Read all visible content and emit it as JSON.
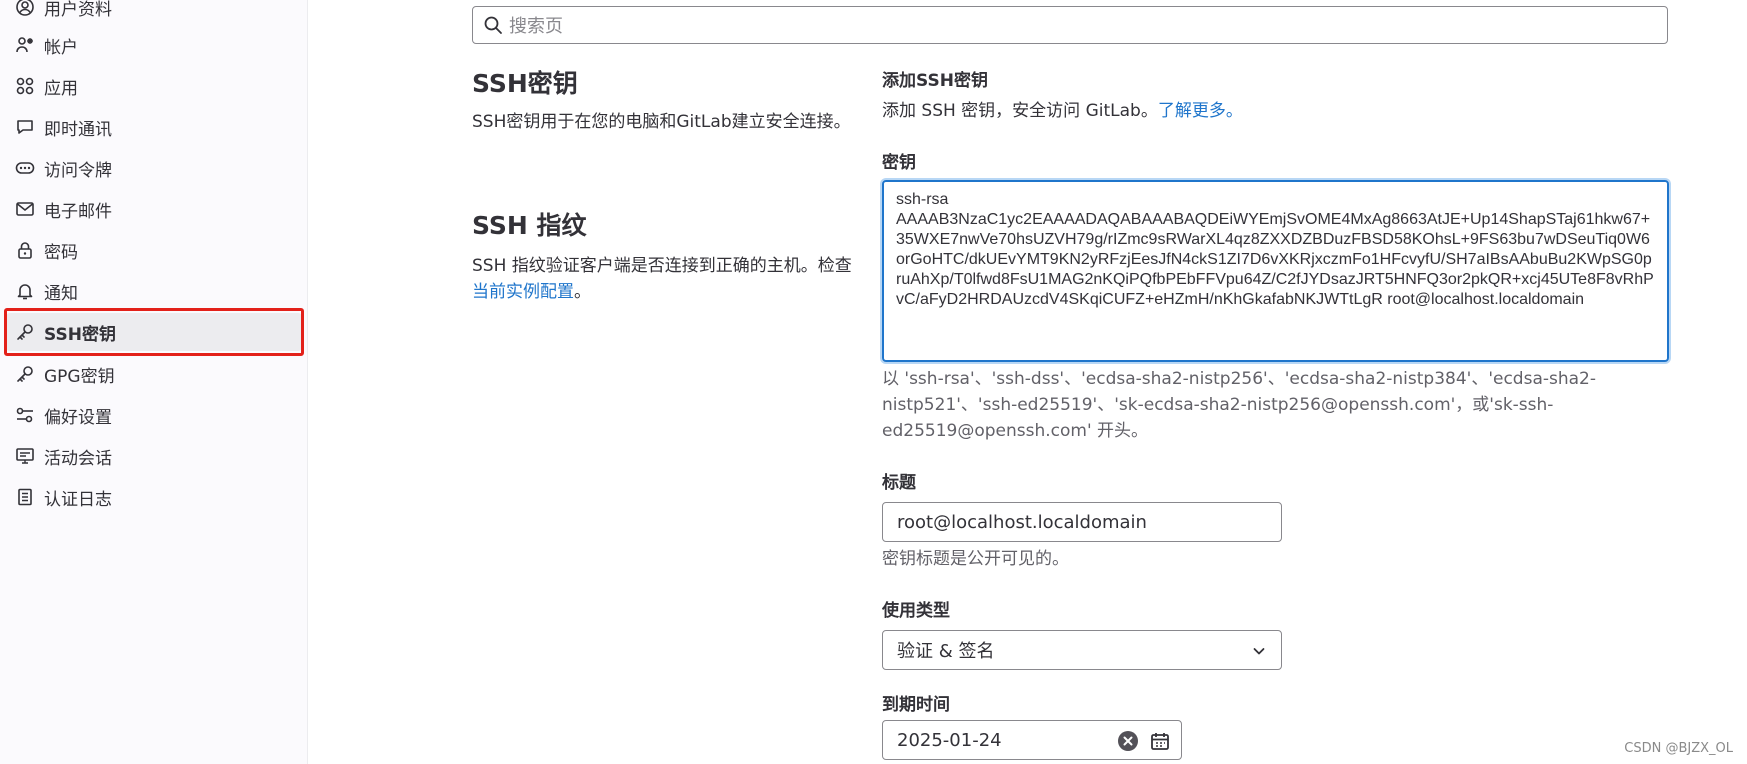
{
  "sidebar": {
    "items": [
      {
        "label": "用户资料",
        "icon": "user-circle-icon"
      },
      {
        "label": "帐户",
        "icon": "account-icon"
      },
      {
        "label": "应用",
        "icon": "applications-icon"
      },
      {
        "label": "即时通讯",
        "icon": "chat-icon"
      },
      {
        "label": "访问令牌",
        "icon": "token-icon"
      },
      {
        "label": "电子邮件",
        "icon": "mail-icon"
      },
      {
        "label": "密码",
        "icon": "lock-icon"
      },
      {
        "label": "通知",
        "icon": "bell-icon"
      },
      {
        "label": "SSH密钥",
        "icon": "key-icon",
        "active": true
      },
      {
        "label": "GPG密钥",
        "icon": "key-icon"
      },
      {
        "label": "偏好设置",
        "icon": "preferences-icon"
      },
      {
        "label": "活动会话",
        "icon": "monitor-icon"
      },
      {
        "label": "认证日志",
        "icon": "log-icon"
      }
    ]
  },
  "search": {
    "placeholder": "搜索页"
  },
  "ssh_keys_section": {
    "title": "SSH密钥",
    "description": "SSH密钥用于在您的电脑和GitLab建立安全连接。"
  },
  "fingerprint_section": {
    "title": "SSH 指纹",
    "description_prefix": "SSH 指纹验证客户端是否连接到正确的主机。检查",
    "link": "当前实例配置",
    "description_suffix": "。"
  },
  "add_key": {
    "heading": "添加SSH密钥",
    "intro_prefix": "添加 SSH 密钥，安全访问 GitLab。",
    "intro_link": "了解更多。",
    "key_label": "密钥",
    "key_value": "ssh-rsa\nAAAAB3NzaC1yc2EAAAADAQABAAABAQDEiWYEmjSvOME4MxAg8663AtJE+Up14ShapSTaj61hkw67+35WXE7nwVe70hsUZVH79g/rIZmc9sRWarXL4qz8ZXXDZBDuzFBSD58KOhsL+9FS63bu7wDSeuTiq0W6orGoHTC/dkUEvYMT9KN2yRFzjEesJfN4ckS1ZI7D6vXKRjxczmFo1HFcvyfU/SH7aIBsAAbuBu2KWpSG0pruAhXp/T0lfwd8FsU1MAG2nKQiPQfbPEbFFVpu64Z/C2fJYDsazJRT5HNFQ3or2pkQR+xcj45UTe8F8vRhPvC/aFyD2HRDAUzcdV4SKqiCUFZ+eHZmH/nKhGkafabNKJWTtLgR root@localhost.localdomain",
    "key_help": "以 'ssh-rsa'、'ssh-dss'、'ecdsa-sha2-nistp256'、'ecdsa-sha2-nistp384'、'ecdsa-sha2-nistp521'、'ssh-ed25519'、'sk-ecdsa-sha2-nistp256@openssh.com'，或'sk-ssh-ed25519@openssh.com' 开头。",
    "title_label": "标题",
    "title_value": "root@localhost.localdomain",
    "title_help": "密钥标题是公开可见的。",
    "usage_label": "使用类型",
    "usage_value": "验证 & 签名",
    "expires_label": "到期时间",
    "expires_value": "2025-01-24"
  },
  "watermark": "CSDN @BJZX_OL",
  "colors": {
    "link": "#1f75cb",
    "focus_border": "#1f75cb",
    "highlight_box": "#e3211a"
  }
}
